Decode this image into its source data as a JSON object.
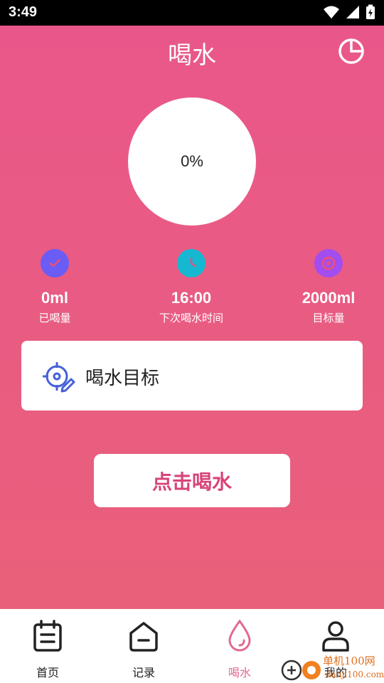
{
  "status": {
    "time": "3:49"
  },
  "header": {
    "title": "喝水",
    "stats_icon": "pie-chart-icon"
  },
  "progress": {
    "percent_text": "0%"
  },
  "stats": [
    {
      "value": "0ml",
      "label": "已喝量",
      "icon": "check-icon",
      "color": "#6a5cf5"
    },
    {
      "value": "16:00",
      "label": "下次喝水时间",
      "icon": "clock-icon",
      "color": "#15b8d0"
    },
    {
      "value": "2000ml",
      "label": "目标量",
      "icon": "target-circle-icon",
      "color": "#a24df0"
    }
  ],
  "goal_card": {
    "label": "喝水目标",
    "icon": "crosshair-edit-icon",
    "icon_color": "#4561d8"
  },
  "drink_button": {
    "label": "点击喝水",
    "color": "#d8447a"
  },
  "tabs": [
    {
      "label": "首页",
      "icon": "calendar-list-icon"
    },
    {
      "label": "记录",
      "icon": "house-icon"
    },
    {
      "label": "喝水",
      "icon": "water-drop-icon",
      "active": true
    },
    {
      "label": "我的",
      "icon": "user-icon"
    }
  ],
  "watermark": {
    "text": "单机100网",
    "subtext": "danji100.com"
  }
}
